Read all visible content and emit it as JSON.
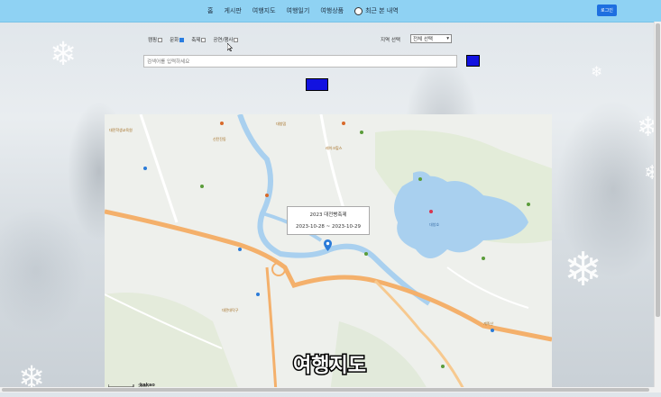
{
  "nav": {
    "items": [
      "홈",
      "게시판",
      "여행지도",
      "여행일기",
      "여행상품"
    ],
    "alerts_label": "최근 본 내역",
    "login_label": "로그인"
  },
  "filters": {
    "items": [
      {
        "label": "캠핑",
        "checked": false
      },
      {
        "label": "문화",
        "checked": true
      },
      {
        "label": "축제",
        "checked": false
      },
      {
        "label": "공연/행사",
        "checked": false
      }
    ],
    "region_label": "지역 선택",
    "region_value": "전체 선택"
  },
  "search": {
    "placeholder": "검색어를 입력하세요"
  },
  "map": {
    "popup_title": "2023 대전빵축제",
    "popup_dates": "2023-10-28 ~ 2023-10-29",
    "scale_label": "500m",
    "brand": "kakao",
    "overlay_title": "여행지도",
    "labels": [
      "대전학생교육원",
      "대청댐",
      "대청호",
      "신탄진동",
      "대전대덕구",
      "레이크힐스",
      "계족산"
    ]
  },
  "colors": {
    "navbar": "#8fd2f3",
    "accent_button": "#1212e0",
    "login_button": "#1e6fe0",
    "water": "#a9d0ef",
    "road": "#f4b06b"
  }
}
